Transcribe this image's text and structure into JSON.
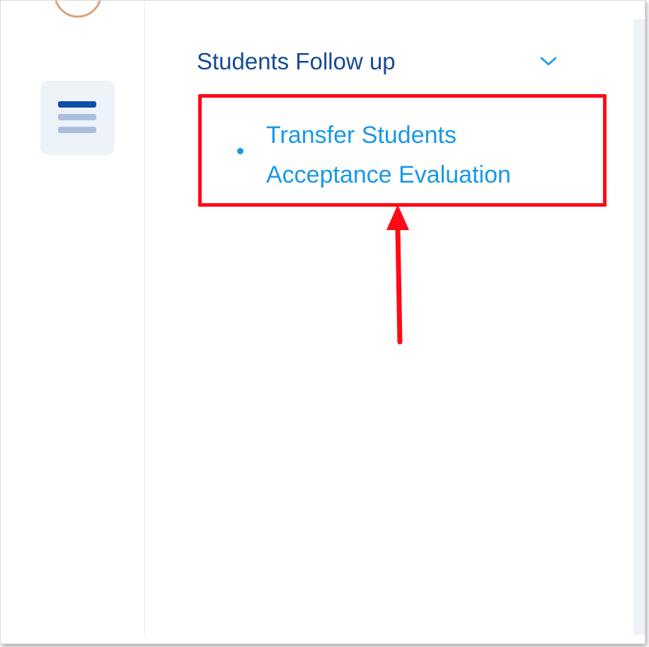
{
  "sidebar": {
    "menu_icon": "hamburger-menu-icon",
    "avatar_icon": "user-avatar-icon"
  },
  "menu": {
    "section_title": "Students Follow up",
    "section_icon": "chevron-down-icon",
    "items": [
      {
        "label": "Transfer Students Acceptance Evaluation",
        "icon": "bullet-dot-icon"
      }
    ]
  },
  "annotation": {
    "highlight_color": "#ff0a16",
    "arrow_icon": "arrow-up-icon"
  },
  "colors": {
    "section_title": "#174a94",
    "item_text": "#1a98e6",
    "menu_bar_active": "#0d4ea6",
    "menu_bar_inactive": "#a9bedb",
    "menu_button_bg": "#eef2f9"
  }
}
